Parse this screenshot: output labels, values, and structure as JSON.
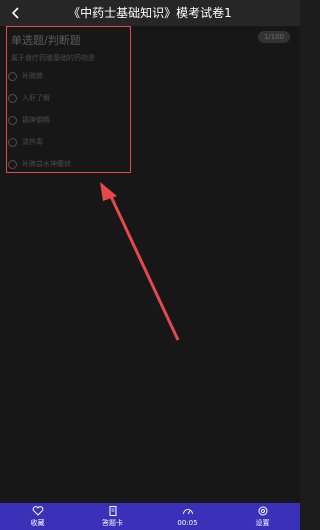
{
  "header": {
    "title": "《中药士基础知识》模考试卷1"
  },
  "question": {
    "type_label": "单选题/判断题",
    "counter": "1/100",
    "stem": "属于食疗药膳基础的药物是",
    "options": [
      "补脾肺",
      "入肝了解",
      "镇神御精",
      "清热毒",
      "补脾益水神腹状"
    ]
  },
  "tabbar": {
    "items": [
      {
        "label": "收藏",
        "icon": "heart-icon"
      },
      {
        "label": "答题卡",
        "icon": "answer-card-icon"
      },
      {
        "label": "00:05",
        "icon": "timer-gauge-icon"
      },
      {
        "label": "设置",
        "icon": "settings-icon"
      }
    ]
  },
  "colors": {
    "accent": "#3b30b8",
    "annotation": "#e5484d"
  }
}
